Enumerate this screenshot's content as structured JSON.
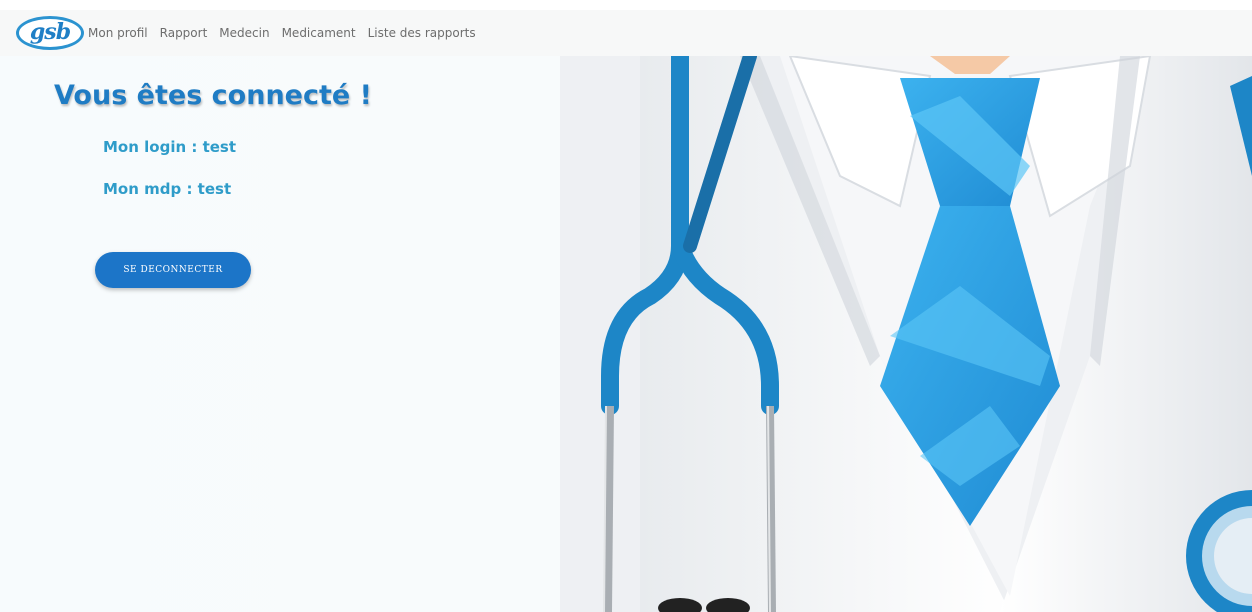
{
  "logo": {
    "text": "gsb"
  },
  "nav": {
    "items": [
      {
        "label": "Mon profil"
      },
      {
        "label": "Rapport"
      },
      {
        "label": "Medecin"
      },
      {
        "label": "Medicament"
      },
      {
        "label": "Liste des rapports"
      }
    ]
  },
  "main": {
    "title": "Vous êtes connecté !",
    "login_line": "Mon login : test",
    "password_line": "Mon mdp : test",
    "logout_button": "SE DECONNECTER"
  },
  "colors": {
    "accent": "#1c75c8",
    "title": "#1f7cc4",
    "info_text": "#2f9cc9",
    "tie": "#2a9fe0"
  },
  "icons": [
    "gsb-logo",
    "doctor-illustration"
  ]
}
